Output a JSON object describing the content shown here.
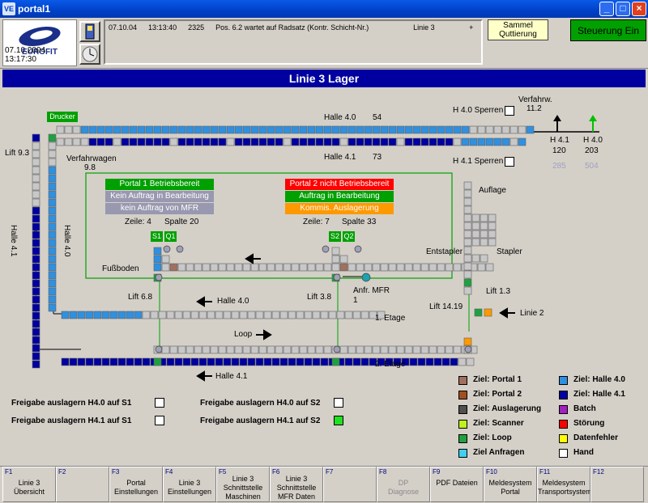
{
  "window": {
    "title": "portal1",
    "icon_text": "VE"
  },
  "logo": {
    "brand": "EUROFIT",
    "datetime": "07.10.2004 13:17:30"
  },
  "message": {
    "date": "07.10.04",
    "time": "13:13:40",
    "code": "2325",
    "text": "Pos. 6.2 wartet auf Radsatz  (Kontr. Schicht-Nr.)",
    "line": "Linie 3",
    "plus": "+"
  },
  "buttons": {
    "sammel": "Sammel\nQuttierung",
    "steuerung": "Steuerung Ein"
  },
  "banner": "Linie 3 Lager",
  "labels": {
    "drucker": "Drucker",
    "halle40_top": "Halle 4.0",
    "halle40_top_val": "54",
    "halle41_top": "Halle 4.1",
    "halle41_top_val": "73",
    "h40_sperren": "H 4.0 Sperren",
    "h41_sperren": "H 4.1 Sperren",
    "verfahrw": "Verfahrw.",
    "verfahrw_val": "11.2",
    "h41": "H 4.1",
    "h41_val": "120",
    "h41_val2": "285",
    "h40": "H 4.0",
    "h40_val": "203",
    "h40_val2": "504",
    "lift93": "Lift 9.3",
    "verfahrwagen": "Verfahrwagen",
    "verfahrwagen_val": "9.8",
    "halle41_side": "Halle 4.1",
    "halle40_side": "Halle 4.0",
    "zeile1": "Zeile: 4",
    "spalte1": "Spalte  20",
    "zeile2": "Zeile: 7",
    "spalte2": "Spalte  33",
    "s1": "S1",
    "q1": "Q1",
    "s2": "S2",
    "q2": "Q2",
    "fussboden": "Fußboden",
    "entstapler": "Entstapler",
    "stapler": "Stapler",
    "auflage": "Auflage",
    "anfr_mfr": "Anfr. MFR",
    "anfr_mfr_val": "1",
    "lift68": "Lift 6.8",
    "lift38": "Lift 3.8",
    "lift1419": "Lift 14.19",
    "lift13": "Lift 1.3",
    "halle40_mid": "Halle 4.0",
    "etage1": "1. Etage",
    "loop": "Loop",
    "linie2": "Linie 2",
    "etage2": "2. Etage",
    "halle41_bottom": "Halle 4.1"
  },
  "status": {
    "p1": {
      "text": "Portal 1 Betriebsbereit",
      "color": "#00a000"
    },
    "p1a": {
      "text": "Kein Auftrag in Bearbeitung",
      "color": "#9898b0"
    },
    "p1b": {
      "text": "kein Auftrag von MFR",
      "color": "#9898b0"
    },
    "p2": {
      "text": "Portal 2 nicht Betriebsbereit",
      "color": "#ff0000"
    },
    "p2a": {
      "text": "Auftrag in Bearbeitung",
      "color": "#00a000"
    },
    "p2b": {
      "text": "Kommis. Auslagerung",
      "color": "#ff9900"
    }
  },
  "freigabe": [
    {
      "text": "Freigabe auslagern H4.0 auf S1",
      "checked": false
    },
    {
      "text": "Freigabe auslagern H4.1 auf S1",
      "checked": false
    },
    {
      "text": "Freigabe auslagern H4.0 auf S2",
      "checked": false
    },
    {
      "text": "Freigabe auslagern H4.1 auf S2",
      "checked": true
    }
  ],
  "legend": [
    {
      "text": "Ziel: Portal 1",
      "color": "#a07060"
    },
    {
      "text": "Ziel: Portal 2",
      "color": "#a05020"
    },
    {
      "text": "Ziel: Auslagerung",
      "color": "#505050"
    },
    {
      "text": "Ziel: Scanner",
      "color": "#c0f020"
    },
    {
      "text": "Ziel: Loop",
      "color": "#20a040"
    },
    {
      "text": "Ziel Anfragen",
      "color": "#40d0f0"
    },
    {
      "text": "Ziel: Halle 4.0",
      "color": "#3090e0"
    },
    {
      "text": "Ziel: Halle 4.1",
      "color": "#0000a0"
    },
    {
      "text": "Batch",
      "color": "#a020c0"
    },
    {
      "text": "Störung",
      "color": "#ff0000"
    },
    {
      "text": "Datenfehler",
      "color": "#ffff00"
    },
    {
      "text": "Hand",
      "color": "#ffffff"
    }
  ],
  "fkeys": [
    {
      "num": "F1",
      "label": "Linie 3\nÜbersicht",
      "state": "active"
    },
    {
      "num": "F2",
      "label": "",
      "state": ""
    },
    {
      "num": "F3",
      "label": "Portal\nEinstellungen",
      "state": ""
    },
    {
      "num": "F4",
      "label": "Linie 3\nEinstellungen",
      "state": ""
    },
    {
      "num": "F5",
      "label": "Linie 3\nSchnittstelle\nMaschinen",
      "state": ""
    },
    {
      "num": "F6",
      "label": "Linie 3\nSchnittstelle\nMFR Daten",
      "state": ""
    },
    {
      "num": "F7",
      "label": "",
      "state": ""
    },
    {
      "num": "F8",
      "label": "DP\nDiagnose",
      "state": "dis"
    },
    {
      "num": "F9",
      "label": "PDF Dateien",
      "state": ""
    },
    {
      "num": "F10",
      "label": "Meldesystem\nPortal",
      "state": ""
    },
    {
      "num": "F11",
      "label": "Meldesystem\nTransportsystem",
      "state": ""
    },
    {
      "num": "F12",
      "label": "",
      "state": ""
    }
  ]
}
